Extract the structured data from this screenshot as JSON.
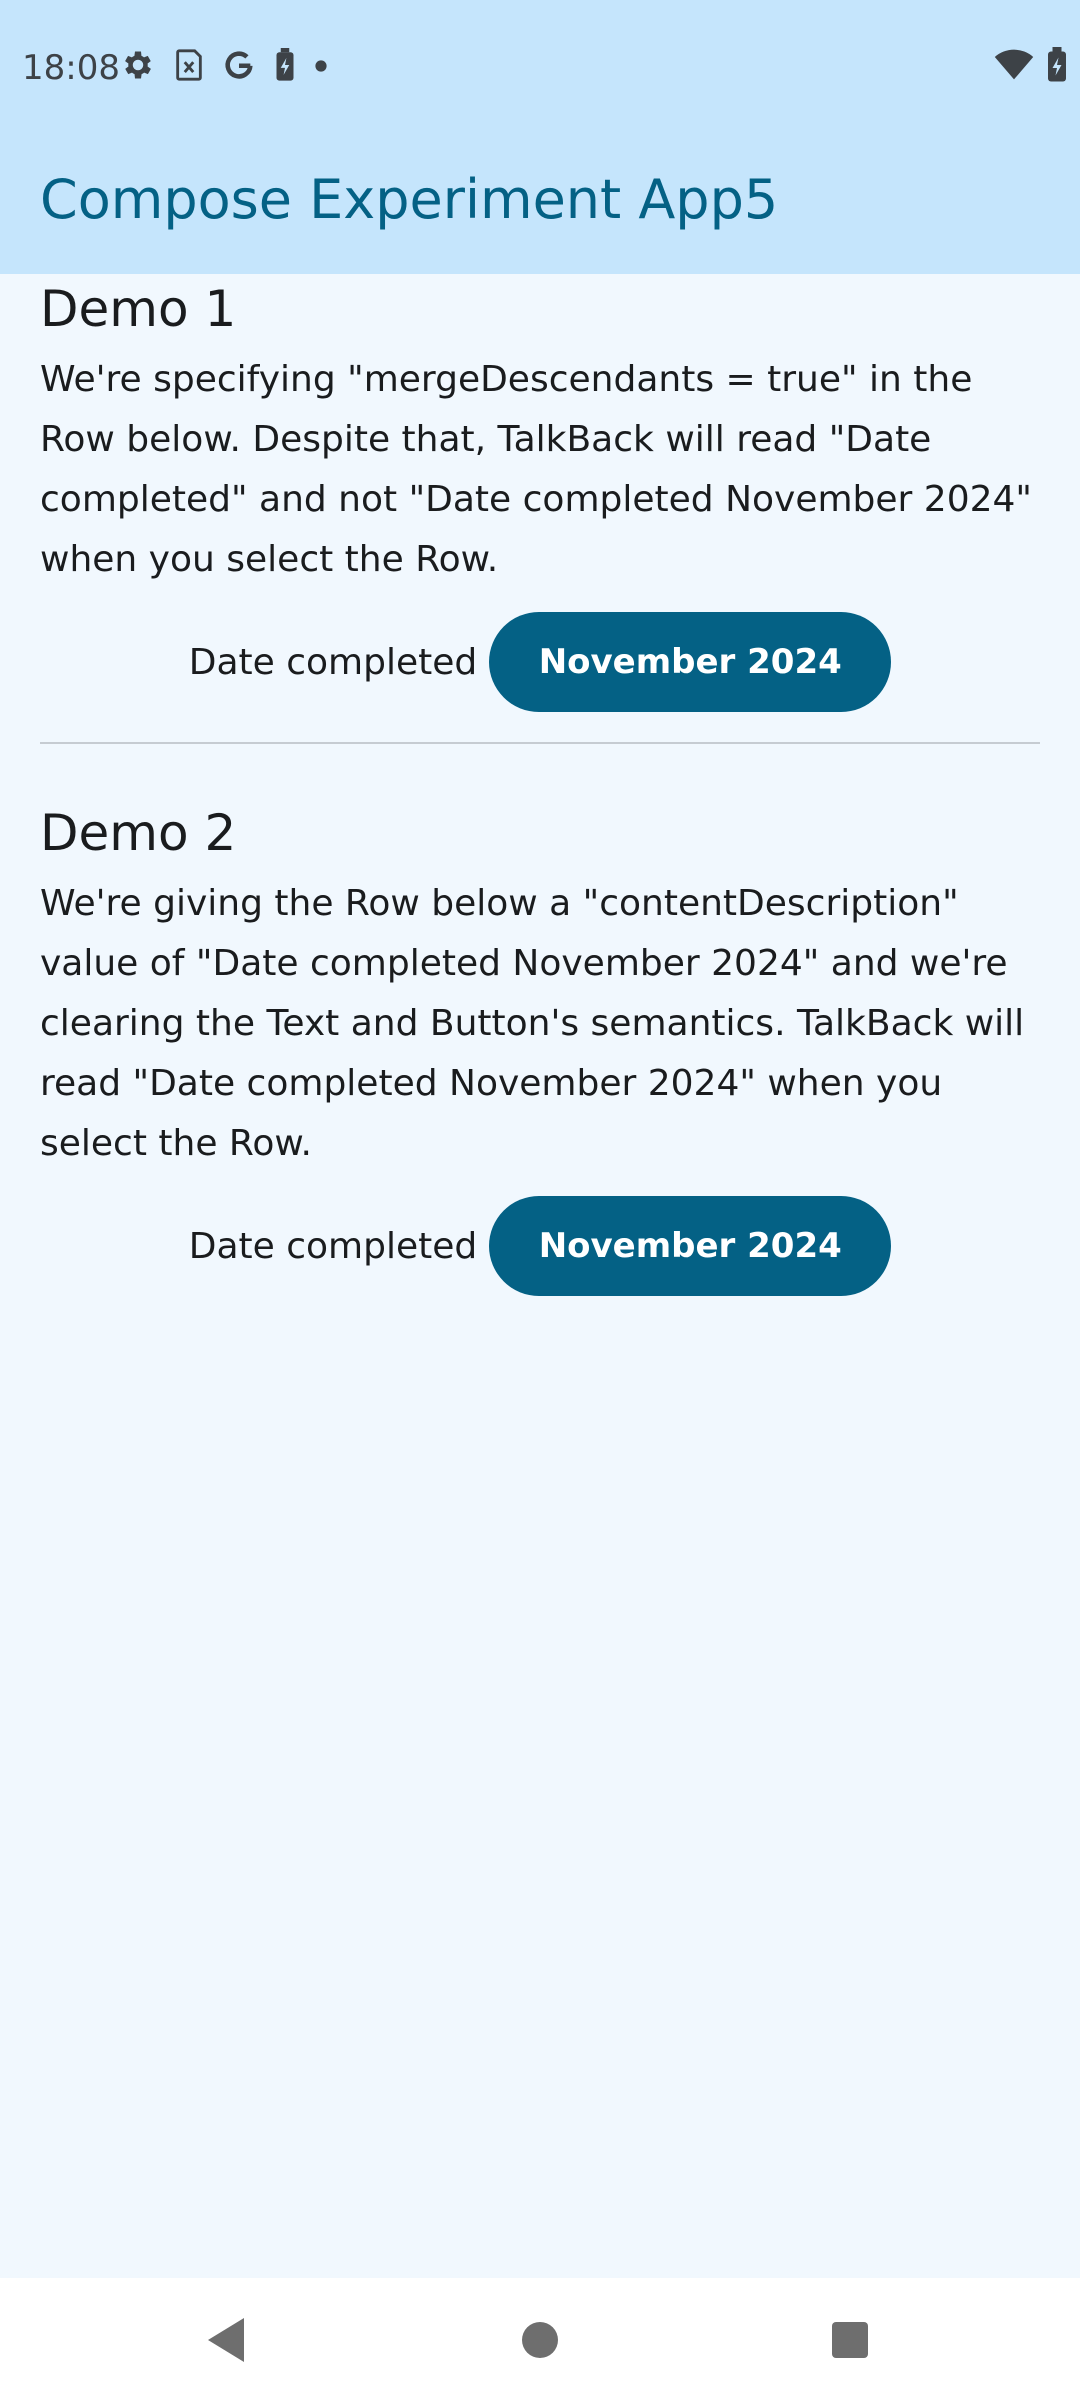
{
  "status_bar": {
    "time": "18:08",
    "left_icons": [
      "settings-gear-icon",
      "sim-card-icon",
      "google-icon",
      "battery-saver-icon",
      "notification-dot-icon"
    ],
    "right_icons": [
      "wifi-icon",
      "battery-charging-icon"
    ]
  },
  "app_bar": {
    "title": "Compose Experiment App5"
  },
  "demo1": {
    "title": "Demo 1",
    "body": "We're specifying \"mergeDescendants = true\" in the Row below. Despite that, TalkBack will read \"Date completed\" and not \"Date completed November 2024\" when you select the Row.",
    "row_label": "Date completed",
    "button_label": "November 2024"
  },
  "demo2": {
    "title": "Demo 2",
    "body": "We're giving the Row below a \"contentDescription\" value of \"Date completed November 2024\" and we're clearing the Text and Button's semantics. TalkBack will read \"Date completed November 2024\" when you select the Row.",
    "row_label": "Date completed",
    "button_label": "November 2024"
  },
  "nav_bar": {
    "icons": [
      "back-icon",
      "home-icon",
      "recents-icon"
    ]
  },
  "colors": {
    "app_bar_bg": "#c5e5fc",
    "background": "#f1f8fe",
    "accent": "#046185",
    "divider": "#c6ccd2"
  }
}
